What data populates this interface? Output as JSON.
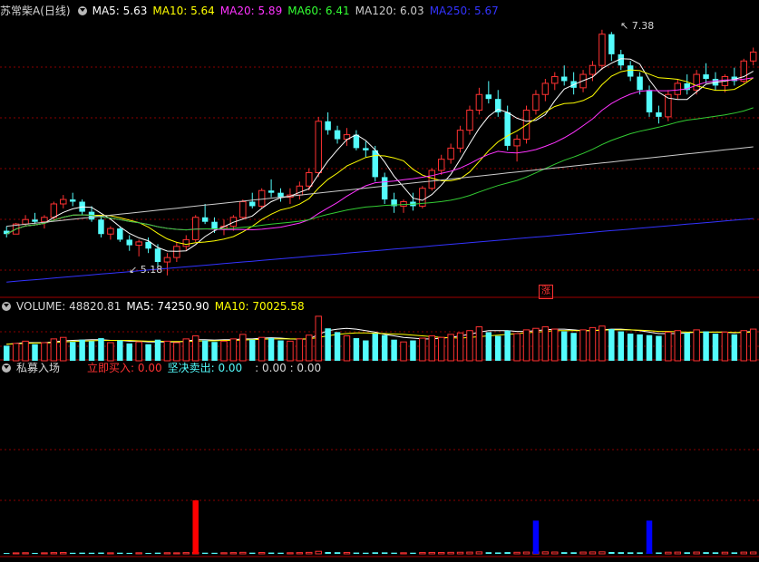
{
  "price_panel": {
    "stock_name": "苏常柴A",
    "period": "(日线)",
    "ma_labels": [
      {
        "text": "MA5: 5.63",
        "color": "#ffffff"
      },
      {
        "text": "MA10: 5.64",
        "color": "#ffff00"
      },
      {
        "text": "MA20: 5.89",
        "color": "#ff33ff"
      },
      {
        "text": "MA60: 6.41",
        "color": "#33ff33"
      },
      {
        "text": "MA120: 6.03",
        "color": "#cccccc"
      },
      {
        "text": "MA250: 5.67",
        "color": "#3333ff"
      }
    ],
    "high_marker": "7.38",
    "low_marker": "5.18",
    "badge": "涨"
  },
  "volume_panel": {
    "label": "VOLUME: 48820.81",
    "ma5": "MA5: 74250.90",
    "ma10": "MA10: 70025.58"
  },
  "indicator_panel": {
    "name": "私募入场",
    "buy_label": "立即买入: 0.00",
    "sell_label": "坚决卖出: 0.00",
    "extra_label": ": 0.00 : 0.00"
  },
  "colors": {
    "up": "#ff3232",
    "down": "#54fcfc",
    "ma5": "#ffffff",
    "ma10": "#ffff00",
    "ma20": "#ff33ff",
    "ma60": "#33cc33",
    "ma120": "#cccccc",
    "ma250": "#3333ff",
    "grid": "#8a0000",
    "buy_signal": "#ff0000",
    "sell_signal": "#0000ff"
  },
  "chart_data": {
    "type": "candlestick",
    "ylim": [
      5.0,
      7.5
    ],
    "high": 7.38,
    "low": 5.18,
    "ohlc": [
      [
        5.58,
        5.62,
        5.52,
        5.55
      ],
      [
        5.55,
        5.65,
        5.55,
        5.64
      ],
      [
        5.64,
        5.72,
        5.62,
        5.68
      ],
      [
        5.68,
        5.74,
        5.64,
        5.66
      ],
      [
        5.66,
        5.72,
        5.6,
        5.7
      ],
      [
        5.7,
        5.84,
        5.68,
        5.82
      ],
      [
        5.82,
        5.9,
        5.78,
        5.86
      ],
      [
        5.86,
        5.92,
        5.8,
        5.84
      ],
      [
        5.84,
        5.86,
        5.72,
        5.75
      ],
      [
        5.75,
        5.8,
        5.66,
        5.68
      ],
      [
        5.68,
        5.72,
        5.52,
        5.55
      ],
      [
        5.55,
        5.62,
        5.5,
        5.6
      ],
      [
        5.6,
        5.62,
        5.48,
        5.5
      ],
      [
        5.5,
        5.54,
        5.4,
        5.45
      ],
      [
        5.45,
        5.5,
        5.35,
        5.48
      ],
      [
        5.48,
        5.52,
        5.38,
        5.42
      ],
      [
        5.42,
        5.46,
        5.26,
        5.3
      ],
      [
        5.3,
        5.38,
        5.18,
        5.34
      ],
      [
        5.34,
        5.48,
        5.3,
        5.44
      ],
      [
        5.44,
        5.54,
        5.4,
        5.5
      ],
      [
        5.5,
        5.72,
        5.48,
        5.7
      ],
      [
        5.7,
        5.82,
        5.64,
        5.66
      ],
      [
        5.66,
        5.7,
        5.56,
        5.6
      ],
      [
        5.6,
        5.68,
        5.54,
        5.62
      ],
      [
        5.62,
        5.72,
        5.58,
        5.7
      ],
      [
        5.7,
        5.86,
        5.68,
        5.84
      ],
      [
        5.84,
        5.92,
        5.78,
        5.8
      ],
      [
        5.8,
        5.96,
        5.78,
        5.94
      ],
      [
        5.94,
        6.04,
        5.88,
        5.92
      ],
      [
        5.92,
        5.96,
        5.84,
        5.88
      ],
      [
        5.88,
        5.96,
        5.82,
        5.9
      ],
      [
        5.9,
        6.02,
        5.86,
        5.98
      ],
      [
        5.98,
        6.14,
        5.94,
        6.1
      ],
      [
        6.1,
        6.6,
        6.06,
        6.56
      ],
      [
        6.56,
        6.64,
        6.44,
        6.48
      ],
      [
        6.48,
        6.52,
        6.36,
        6.4
      ],
      [
        6.4,
        6.5,
        6.34,
        6.44
      ],
      [
        6.44,
        6.48,
        6.3,
        6.32
      ],
      [
        6.32,
        6.38,
        6.24,
        6.3
      ],
      [
        6.3,
        6.34,
        6.02,
        6.06
      ],
      [
        6.06,
        6.1,
        5.82,
        5.86
      ],
      [
        5.86,
        5.92,
        5.74,
        5.8
      ],
      [
        5.8,
        5.86,
        5.74,
        5.84
      ],
      [
        5.84,
        5.92,
        5.76,
        5.8
      ],
      [
        5.8,
        5.98,
        5.78,
        5.96
      ],
      [
        5.96,
        6.14,
        5.94,
        6.12
      ],
      [
        6.12,
        6.26,
        6.08,
        6.22
      ],
      [
        6.22,
        6.36,
        6.18,
        6.32
      ],
      [
        6.32,
        6.52,
        6.28,
        6.48
      ],
      [
        6.48,
        6.7,
        6.44,
        6.66
      ],
      [
        6.66,
        6.86,
        6.62,
        6.8
      ],
      [
        6.8,
        6.92,
        6.72,
        6.76
      ],
      [
        6.76,
        6.84,
        6.6,
        6.64
      ],
      [
        6.64,
        6.7,
        6.3,
        6.34
      ],
      [
        6.34,
        6.44,
        6.2,
        6.4
      ],
      [
        6.4,
        6.7,
        6.36,
        6.66
      ],
      [
        6.66,
        6.84,
        6.62,
        6.8
      ],
      [
        6.8,
        6.94,
        6.74,
        6.9
      ],
      [
        6.9,
        7.0,
        6.84,
        6.96
      ],
      [
        6.96,
        7.06,
        6.88,
        6.92
      ],
      [
        6.92,
        7.0,
        6.8,
        6.86
      ],
      [
        6.86,
        7.02,
        6.82,
        6.98
      ],
      [
        6.98,
        7.1,
        6.92,
        7.06
      ],
      [
        7.06,
        7.38,
        7.02,
        7.34
      ],
      [
        7.34,
        7.36,
        7.1,
        7.16
      ],
      [
        7.16,
        7.2,
        7.02,
        7.06
      ],
      [
        7.06,
        7.1,
        6.92,
        6.96
      ],
      [
        6.96,
        7.0,
        6.8,
        6.84
      ],
      [
        6.84,
        6.88,
        6.6,
        6.64
      ],
      [
        6.64,
        6.7,
        6.54,
        6.6
      ],
      [
        6.6,
        6.84,
        6.56,
        6.8
      ],
      [
        6.8,
        6.94,
        6.76,
        6.9
      ],
      [
        6.9,
        6.98,
        6.8,
        6.84
      ],
      [
        6.84,
        7.02,
        6.8,
        6.98
      ],
      [
        6.98,
        7.08,
        6.9,
        6.94
      ],
      [
        6.94,
        7.0,
        6.84,
        6.88
      ],
      [
        6.88,
        6.98,
        6.82,
        6.96
      ],
      [
        6.96,
        7.04,
        6.88,
        6.92
      ],
      [
        6.92,
        7.12,
        6.9,
        7.1
      ],
      [
        7.1,
        7.22,
        7.06,
        7.18
      ]
    ],
    "volume": [
      40,
      46,
      52,
      44,
      48,
      58,
      62,
      50,
      56,
      52,
      60,
      48,
      54,
      46,
      50,
      44,
      56,
      52,
      48,
      58,
      66,
      54,
      50,
      52,
      58,
      70,
      56,
      62,
      60,
      54,
      52,
      58,
      68,
      118,
      86,
      76,
      66,
      60,
      54,
      72,
      68,
      56,
      50,
      54,
      60,
      66,
      62,
      70,
      74,
      80,
      90,
      76,
      66,
      80,
      72,
      82,
      86,
      90,
      84,
      78,
      74,
      82,
      88,
      92,
      84,
      78,
      72,
      70,
      68,
      66,
      76,
      80,
      74,
      82,
      78,
      72,
      76,
      70,
      80,
      84
    ],
    "vol_ma5": [
      44,
      46,
      48,
      48,
      48,
      50,
      53,
      54,
      55,
      56,
      56,
      54,
      54,
      52,
      52,
      50,
      50,
      50,
      50,
      52,
      56,
      56,
      55,
      56,
      56,
      58,
      58,
      60,
      61,
      60,
      58,
      57,
      58,
      70,
      80,
      84,
      86,
      84,
      80,
      76,
      70,
      66,
      62,
      60,
      58,
      58,
      60,
      62,
      66,
      70,
      76,
      80,
      80,
      80,
      78,
      78,
      80,
      82,
      84,
      84,
      82,
      80,
      80,
      82,
      84,
      84,
      82,
      80,
      76,
      72,
      72,
      72,
      74,
      76,
      76,
      76,
      76,
      74,
      76,
      78
    ],
    "vol_ma10": [
      44,
      45,
      46,
      47,
      47,
      48,
      50,
      51,
      52,
      53,
      54,
      54,
      54,
      54,
      53,
      52,
      52,
      51,
      51,
      51,
      52,
      53,
      53,
      54,
      54,
      55,
      56,
      57,
      58,
      58,
      58,
      58,
      58,
      62,
      66,
      70,
      72,
      74,
      74,
      73,
      72,
      71,
      70,
      68,
      66,
      64,
      62,
      61,
      60,
      62,
      64,
      66,
      68,
      70,
      72,
      74,
      76,
      78,
      80,
      80,
      80,
      80,
      80,
      81,
      82,
      82,
      82,
      81,
      80,
      78,
      78,
      77,
      76,
      76,
      76,
      76,
      76,
      75,
      75,
      76
    ],
    "signal_buy": [
      {
        "index": 20,
        "value": 1.0
      }
    ],
    "signal_sell": [
      {
        "index": 56,
        "value": 0.62
      },
      {
        "index": 68,
        "value": 0.62
      }
    ]
  }
}
